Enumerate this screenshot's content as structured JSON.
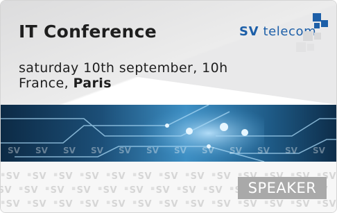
{
  "event": {
    "title": "IT Conference",
    "date": "saturday 10th september, 10h",
    "country": "France,",
    "city": "Paris"
  },
  "logo": {
    "brand_short": "SV",
    "brand_name": "telecom"
  },
  "badge": {
    "role": "SPEAKER"
  },
  "watermark": {
    "text": "SV"
  },
  "colors": {
    "logo_blue": "#1d5fa8",
    "band_blue": "#3d8fc4",
    "role_bg": "#a9a9a9",
    "shade": "#e9e9ea"
  }
}
